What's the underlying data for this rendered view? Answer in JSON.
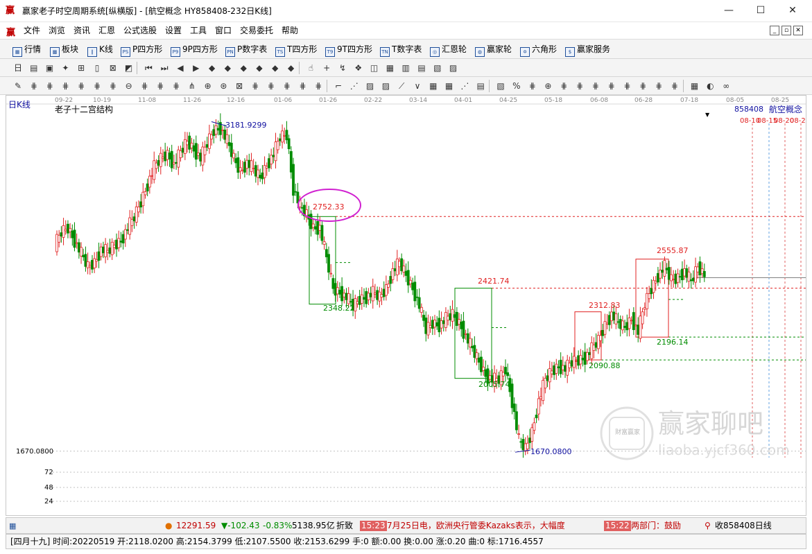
{
  "window": {
    "app_icon": "赢",
    "title": "赢家老子时空周期系统[纵横版] - [航空概念  HY858408-232日K线]",
    "minimize": "—",
    "maximize": "☐",
    "close": "✕"
  },
  "menu": {
    "icon": "赢",
    "items": [
      "文件",
      "浏览",
      "资讯",
      "汇恩",
      "公式选股",
      "设置",
      "工具",
      "窗口",
      "交易委托",
      "帮助"
    ],
    "mdi": [
      "_",
      "▫",
      "✕"
    ]
  },
  "toolbar1": {
    "items": [
      {
        "icon": "▦",
        "label": "行情"
      },
      {
        "icon": "▩",
        "label": "板块"
      },
      {
        "icon": "∥",
        "label": "K线"
      },
      {
        "icon": "PS",
        "label": "P四方形"
      },
      {
        "icon": "P9",
        "label": "9P四方形"
      },
      {
        "icon": "PN",
        "label": "P数字表"
      },
      {
        "icon": "TS",
        "label": "T四方形"
      },
      {
        "icon": "T9",
        "label": "9T四方形"
      },
      {
        "icon": "TN",
        "label": "T数字表"
      },
      {
        "icon": "◎",
        "label": "汇恩轮"
      },
      {
        "icon": "◍",
        "label": "赢家轮"
      },
      {
        "icon": "✡",
        "label": "六角形"
      },
      {
        "icon": "$",
        "label": "赢家服务"
      }
    ]
  },
  "toolbar2_icons": [
    "日",
    "▤",
    "▣",
    "✦",
    "⊞",
    "▯",
    "⊠",
    "◩",
    "⏮",
    "⏭",
    "◀",
    "▶",
    "◆",
    "◆",
    "◆",
    "◆",
    "◆",
    "◆",
    "☝",
    "+",
    "↯",
    "❖",
    "◫",
    "▦",
    "▥",
    "▤",
    "▧",
    "▨"
  ],
  "toolbar3_icons": [
    "✎",
    "⋕",
    "⋕",
    "⋕",
    "⋕",
    "⋕",
    "⋕",
    "⊖",
    "⋕",
    "⋕",
    "⋕",
    "⋔",
    "⊕",
    "⊛",
    "⊠",
    "⋕",
    "⋕",
    "⋕",
    "⋕",
    "⋕",
    "⌐",
    "⋰",
    "▨",
    "▨",
    "⟋",
    "∨",
    "▦",
    "▦",
    "⋰",
    "▤",
    "▧",
    "%",
    "⋕",
    "⊕",
    "⋕",
    "⋕",
    "⋕",
    "⋕",
    "⋕",
    "⋕",
    "⋕",
    "⋕",
    "▦",
    "◐",
    "∞"
  ],
  "chart": {
    "period": "日K线",
    "indicator_name": "老子十二宫结构",
    "code": "858408",
    "name": "航空概念",
    "date_axis": [
      "09-22",
      "10-19",
      "11-08",
      "11-26",
      "12-16",
      "01-06",
      "01-26",
      "02-22",
      "03-14",
      "04-01",
      "04-25",
      "05-18",
      "06-08",
      "06-28",
      "07-18",
      "08-05",
      "08-25"
    ],
    "future_dates": [
      "08-10",
      "08-15",
      "08-20",
      "08-25"
    ],
    "price_labels": {
      "high": "3181.9299",
      "p2752": "2752.33",
      "p2348": "2348.22",
      "p2421": "2421.74",
      "p2005": "2005.74",
      "p2555": "2555.87",
      "p2312": "2312.83",
      "p2196": "2196.14",
      "p2090": "2090.88",
      "low": "1670.0800"
    },
    "left_axis": [
      "1670.0800",
      "72",
      "48",
      "24"
    ]
  },
  "watermark": {
    "badge": "财富赢家",
    "text": "赢家聊吧",
    "url": "liaoba.yjcf360.com"
  },
  "ticker": {
    "index_value": "12291.59",
    "index_change": "▼-102.43",
    "index_pct": "-0.83%",
    "index_amount": "5138.95亿",
    "trailing": "折致",
    "news1_time": "15:23",
    "news1_text": "7月25日电，欧洲央行管委Kazaks表示，大幅度",
    "news2_time": "15:22",
    "news2_text": "两部门：鼓励",
    "right_text": "收858408日线"
  },
  "status": {
    "text": "[四月十九] 时间:20220519 开:2118.0200 高:2154.3799 低:2107.5500 收:2153.6299 手:0 额:0.00 换:0.00 涨:0.20 曲:0 标:1716.4557"
  },
  "colors": {
    "up": "#e02020",
    "down": "#008c00",
    "support": "#008c00",
    "resistance": "#e02020",
    "highlight_circle": "#d020d0",
    "blue_text": "#1010a0"
  },
  "chart_data": {
    "type": "candlestick",
    "title": "老子十二宫结构",
    "xlabel": "",
    "ylabel": "",
    "ylim": [
      1640,
      3230
    ],
    "x_ticks": [
      "09-22",
      "10-19",
      "11-08",
      "11-26",
      "12-16",
      "01-06",
      "01-26",
      "02-22",
      "03-14",
      "04-01",
      "04-25",
      "05-18",
      "06-08",
      "06-28",
      "07-18",
      "08-05",
      "08-25"
    ],
    "annotations": [
      {
        "label": "3181.9299",
        "value": 3181.93
      },
      {
        "label": "2752.33",
        "value": 2752.33
      },
      {
        "label": "2348.22",
        "value": 2348.22
      },
      {
        "label": "2421.74",
        "value": 2421.74
      },
      {
        "label": "2005.74",
        "value": 2005.74
      },
      {
        "label": "2555.87",
        "value": 2555.87
      },
      {
        "label": "2312.83",
        "value": 2312.83
      },
      {
        "label": "2196.14",
        "value": 2196.14
      },
      {
        "label": "2090.88",
        "value": 2090.88
      },
      {
        "label": "1670.0800",
        "value": 1670.08
      }
    ],
    "close_path": [
      2620,
      2680,
      2700,
      2640,
      2580,
      2520,
      2540,
      2600,
      2590,
      2620,
      2640,
      2700,
      2750,
      2820,
      2900,
      2980,
      3020,
      3040,
      2990,
      3050,
      3100,
      3060,
      3020,
      3090,
      3150,
      3160,
      3100,
      3020,
      2960,
      3000,
      2970,
      2930,
      2990,
      3040,
      3120,
      3130,
      2880,
      2800,
      2760,
      2700,
      2700,
      2560,
      2420,
      2400,
      2380,
      2340,
      2370,
      2380,
      2400,
      2380,
      2420,
      2500,
      2540,
      2480,
      2420,
      2340,
      2230,
      2260,
      2250,
      2280,
      2300,
      2260,
      2200,
      2140,
      2080,
      2020,
      2000,
      2000,
      2050,
      1900,
      1720,
      1680,
      1760,
      1900,
      2000,
      2040,
      2060,
      2050,
      2080,
      2090,
      2100,
      2140,
      2180,
      2250,
      2300,
      2260,
      2240,
      2280,
      2220,
      2350,
      2420,
      2480,
      2520,
      2460,
      2470,
      2500,
      2450,
      2520,
      2480
    ]
  }
}
